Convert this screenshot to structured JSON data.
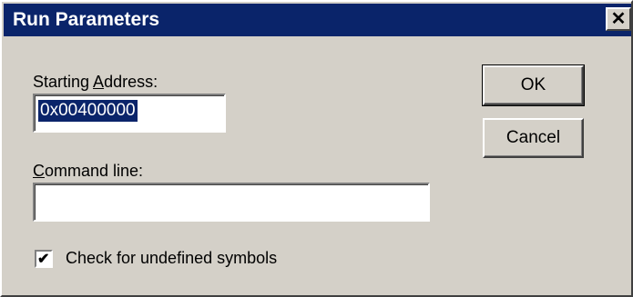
{
  "window": {
    "title": "Run Parameters",
    "close_glyph": "✕"
  },
  "starting_address": {
    "label_prefix": "Starting ",
    "label_accel": "A",
    "label_suffix": "ddress:",
    "value": "0x00400000"
  },
  "command_line": {
    "label_accel": "C",
    "label_suffix": "ommand line:",
    "value": ""
  },
  "checkbox": {
    "label": "Check for undefined symbols",
    "checked": true,
    "check_glyph": "✔"
  },
  "buttons": {
    "ok": "OK",
    "cancel": "Cancel"
  },
  "colors": {
    "titlebar": "#0a246a",
    "face": "#d4d0c8",
    "selection": "#0a246a"
  }
}
